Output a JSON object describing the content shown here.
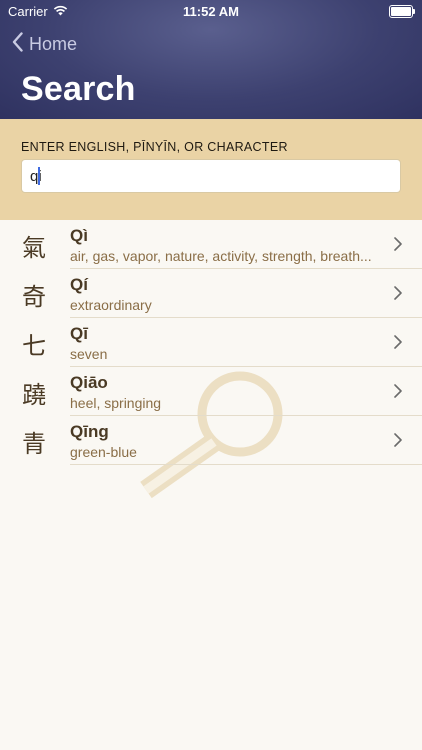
{
  "status_bar": {
    "carrier": "Carrier",
    "time": "11:52 AM"
  },
  "nav": {
    "back_label": "Home",
    "title": "Search"
  },
  "search": {
    "label": "ENTER ENGLISH, PĪNYĪN, OR CHARACTER",
    "value": "qi"
  },
  "results": [
    {
      "hanzi": "氣",
      "pinyin": "Qì",
      "meaning": "air, gas, vapor, nature, activity, strength, breath..."
    },
    {
      "hanzi": "奇",
      "pinyin": "Qí",
      "meaning": "extraordinary"
    },
    {
      "hanzi": "七",
      "pinyin": "Qī",
      "meaning": "seven"
    },
    {
      "hanzi": "蹺",
      "pinyin": "Qiāo",
      "meaning": "heel, springing"
    },
    {
      "hanzi": "青",
      "pinyin": "Qīng",
      "meaning": "green-blue"
    }
  ],
  "colors": {
    "header": "#3d4170",
    "search_panel": "#ead3a5",
    "text_primary": "#4a3a24",
    "text_secondary": "#8a6e47",
    "background": "#faf8f3"
  },
  "icons": [
    "wifi-icon",
    "battery-icon",
    "back-chevron-icon",
    "chevron-right-icon",
    "magnifier-watermark-icon"
  ]
}
